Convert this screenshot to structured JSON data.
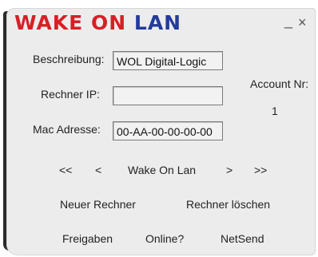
{
  "title": {
    "part1": "WAKE",
    "part2": "ON",
    "part3": "LAN"
  },
  "window_controls": {
    "minimize": "_",
    "close": "×"
  },
  "form": {
    "description_label": "Beschreibung:",
    "description_value": "WOL Digital-Logic",
    "ip_label": "Rechner IP:",
    "ip_value": "",
    "mac_label": "Mac Adresse:",
    "mac_value": "00-AA-00-00-00-00"
  },
  "account": {
    "label": "Account Nr:",
    "value": "1"
  },
  "nav": {
    "first": "<<",
    "prev": "<",
    "center": "Wake On Lan",
    "next": ">",
    "last": ">>"
  },
  "actions": {
    "new_computer": "Neuer Rechner",
    "delete_computer": "Rechner löschen",
    "shares": "Freigaben",
    "online": "Online?",
    "netsend": "NetSend"
  },
  "colors": {
    "title_red": "#d81f26",
    "title_blue": "#243b9a"
  }
}
